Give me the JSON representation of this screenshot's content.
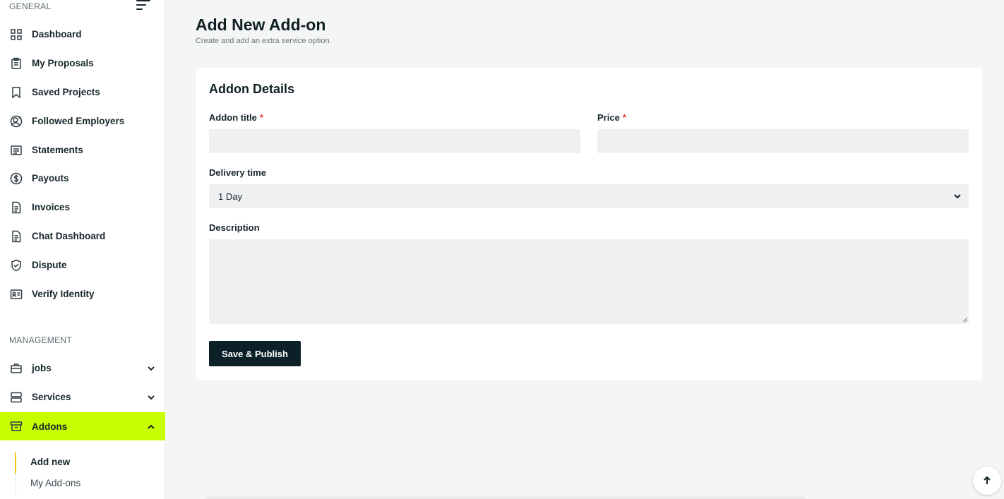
{
  "sidebar": {
    "general_label": "GENERAL",
    "management_label": "MANAGEMENT",
    "general_items": [
      {
        "label": "Dashboard",
        "icon": "grid-icon"
      },
      {
        "label": "My Proposals",
        "icon": "clipboard-icon"
      },
      {
        "label": "Saved Projects",
        "icon": "bookmark-icon"
      },
      {
        "label": "Followed Employers",
        "icon": "user-follow-icon"
      },
      {
        "label": "Statements",
        "icon": "list-icon"
      },
      {
        "label": "Payouts",
        "icon": "dollar-icon"
      },
      {
        "label": "Invoices",
        "icon": "document-icon"
      },
      {
        "label": "Chat Dashboard",
        "icon": "document-icon"
      },
      {
        "label": "Dispute",
        "icon": "shield-icon"
      },
      {
        "label": "Verify Identity",
        "icon": "id-card-icon"
      }
    ],
    "management_items": [
      {
        "label": "jobs",
        "icon": "briefcase-icon"
      },
      {
        "label": "Services",
        "icon": "server-icon"
      },
      {
        "label": "Addons",
        "icon": "archive-icon"
      }
    ],
    "addons_sub": [
      {
        "label": "Add new"
      },
      {
        "label": "My Add-ons"
      }
    ]
  },
  "header": {
    "title": "Add New Add-on",
    "subtitle": "Create and add an extra service option."
  },
  "form": {
    "card_title": "Addon Details",
    "addon_title_label": "Addon title",
    "addon_title_value": "",
    "price_label": "Price",
    "price_value": "",
    "required_mark": "*",
    "delivery_label": "Delivery time",
    "delivery_value": "1 Day",
    "description_label": "Description",
    "description_value": "",
    "save_label": "Save & Publish"
  },
  "colors": {
    "accent": "#c7ff00",
    "button_bg": "#0b2027",
    "required": "#e53935",
    "sub_active_bar": "#f1c40f"
  }
}
